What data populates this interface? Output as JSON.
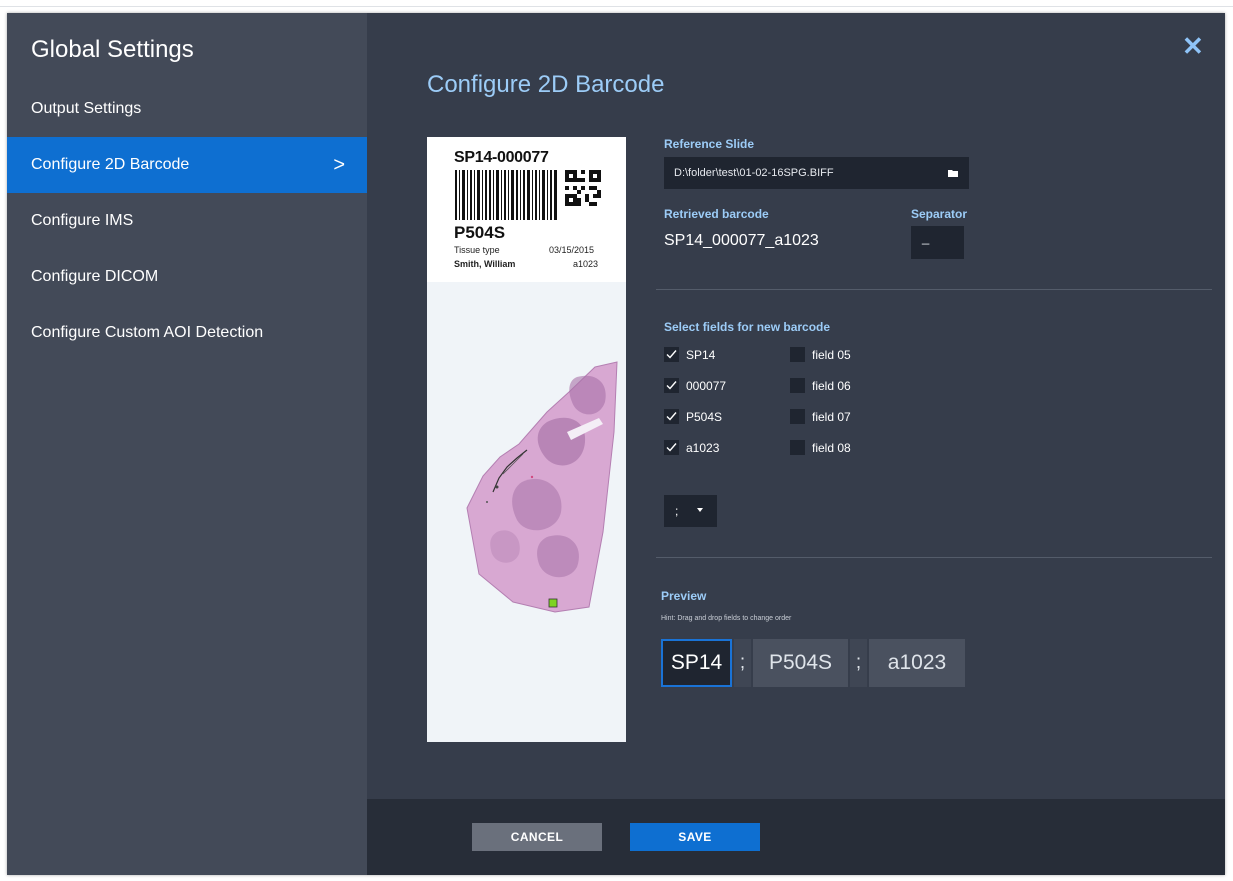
{
  "sidebar": {
    "title": "Global Settings",
    "items": [
      {
        "label": "Output Settings",
        "active": false
      },
      {
        "label": "Configure 2D Barcode",
        "active": true
      },
      {
        "label": "Configure IMS",
        "active": false
      },
      {
        "label": "Configure DICOM",
        "active": false
      },
      {
        "label": "Configure Custom AOI Detection",
        "active": false
      }
    ],
    "active_chevron": ">"
  },
  "main": {
    "close_icon": "close-icon",
    "title": "Configure 2D Barcode",
    "slide_label": {
      "slide_id": "SP14-000077",
      "stain": "P504S",
      "tissue_type": "Tissue type",
      "date": "03/15/2015",
      "patient": "Smith, William",
      "code": "a1023"
    },
    "reference_slide": {
      "label": "Reference Slide",
      "value": "D:\\folder\\test\\01-02-16SPG.BIFF",
      "icon": "folder-icon"
    },
    "retrieved_barcode": {
      "label": "Retrieved barcode",
      "value": "SP14_000077_a1023"
    },
    "separator": {
      "label": "Separator",
      "value": "_"
    },
    "fields": {
      "label": "Select fields for new barcode",
      "items": [
        {
          "label": "SP14",
          "checked": true
        },
        {
          "label": "000077",
          "checked": true
        },
        {
          "label": "P504S",
          "checked": true
        },
        {
          "label": "a1023",
          "checked": true
        },
        {
          "label": "field 05",
          "checked": false
        },
        {
          "label": "field 06",
          "checked": false
        },
        {
          "label": "field 07",
          "checked": false
        },
        {
          "label": "field 08",
          "checked": false
        }
      ]
    },
    "join_separator": {
      "value": ";"
    },
    "preview": {
      "label": "Preview",
      "hint": "Hint: Drag and drop fields to change order",
      "chips": [
        "SP14",
        "P504S",
        "a1023"
      ],
      "separator": ";"
    }
  },
  "footer": {
    "cancel_label": "CANCEL",
    "save_label": "SAVE"
  },
  "colors": {
    "accent": "#0e6fd1",
    "label_blue": "#9cccf7",
    "sidebar_bg": "#434a58",
    "main_bg": "#363d4b",
    "footer_bg": "#272d38",
    "input_bg": "#1f2530"
  }
}
